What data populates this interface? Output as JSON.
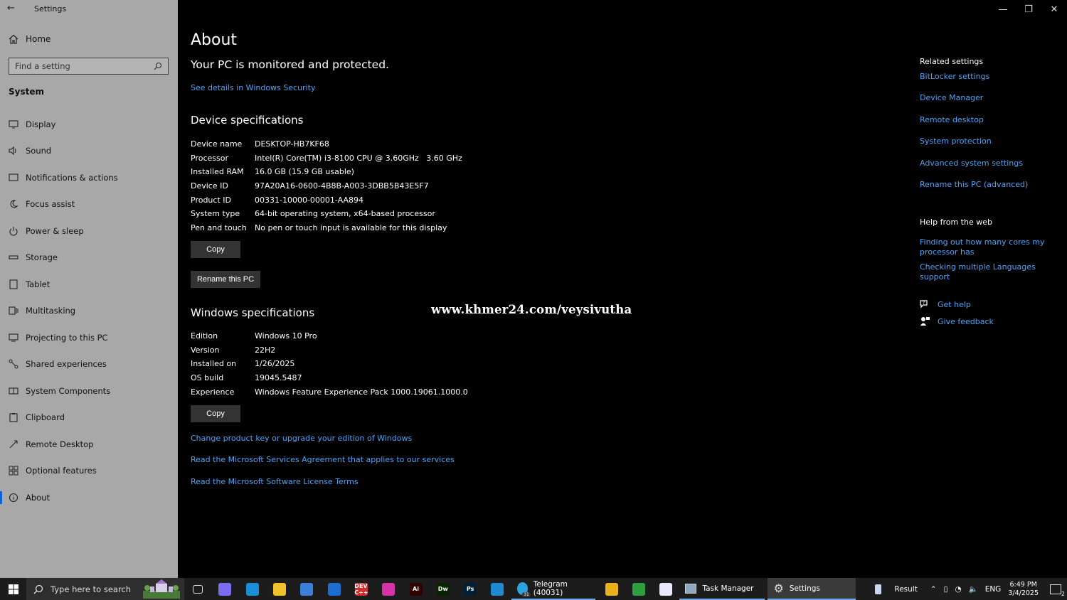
{
  "window": {
    "title": "Settings",
    "back_glyph": "←",
    "minimize_glyph": "—",
    "maximize_glyph": "❐",
    "close_glyph": "✕"
  },
  "sidebar": {
    "home_label": "Home",
    "search_placeholder": "Find a setting",
    "section_title": "System",
    "items": [
      {
        "label": "Display",
        "icon": "display-icon"
      },
      {
        "label": "Sound",
        "icon": "sound-icon"
      },
      {
        "label": "Notifications & actions",
        "icon": "notifications-icon"
      },
      {
        "label": "Focus assist",
        "icon": "moon-icon"
      },
      {
        "label": "Power & sleep",
        "icon": "power-icon"
      },
      {
        "label": "Storage",
        "icon": "storage-icon"
      },
      {
        "label": "Tablet",
        "icon": "tablet-icon"
      },
      {
        "label": "Multitasking",
        "icon": "multitasking-icon"
      },
      {
        "label": "Projecting to this PC",
        "icon": "projecting-icon"
      },
      {
        "label": "Shared experiences",
        "icon": "shared-icon"
      },
      {
        "label": "System Components",
        "icon": "components-icon"
      },
      {
        "label": "Clipboard",
        "icon": "clipboard-icon"
      },
      {
        "label": "Remote Desktop",
        "icon": "remote-desktop-icon"
      },
      {
        "label": "Optional features",
        "icon": "optional-features-icon"
      },
      {
        "label": "About",
        "icon": "info-icon",
        "active": true
      }
    ]
  },
  "main": {
    "title": "About",
    "protection_title": "Your PC is monitored and protected.",
    "security_link": "See details in Windows Security",
    "device_specs_title": "Device specifications",
    "device_specs": [
      {
        "key": "Device name",
        "value": "DESKTOP-HB7KF68"
      },
      {
        "key": "Processor",
        "value": "Intel(R) Core(TM) i3-8100 CPU @ 3.60GHz   3.60 GHz"
      },
      {
        "key": "Installed RAM",
        "value": "16.0 GB (15.9 GB usable)"
      },
      {
        "key": "Device ID",
        "value": "97A20A16-0600-4B8B-A003-3DBB5B43E5F7"
      },
      {
        "key": "Product ID",
        "value": "00331-10000-00001-AA894"
      },
      {
        "key": "System type",
        "value": "64-bit operating system, x64-based processor"
      },
      {
        "key": "Pen and touch",
        "value": "No pen or touch input is available for this display"
      }
    ],
    "copy_label": "Copy",
    "rename_label": "Rename this PC",
    "windows_specs_title": "Windows specifications",
    "windows_specs": [
      {
        "key": "Edition",
        "value": "Windows 10 Pro"
      },
      {
        "key": "Version",
        "value": "22H2"
      },
      {
        "key": "Installed on",
        "value": "1/26/2025"
      },
      {
        "key": "OS build",
        "value": "19045.5487"
      },
      {
        "key": "Experience",
        "value": "Windows Feature Experience Pack 1000.19061.1000.0"
      }
    ],
    "copy2_label": "Copy",
    "links": [
      "Change product key or upgrade your edition of Windows",
      "Read the Microsoft Services Agreement that applies to our services",
      "Read the Microsoft Software License Terms"
    ],
    "watermark": "www.khmer24.com/veysivutha"
  },
  "related": {
    "title": "Related settings",
    "links": [
      "BitLocker settings",
      "Device Manager",
      "Remote desktop",
      "System protection",
      "Advanced system settings",
      "Rename this PC (advanced)"
    ],
    "help_title": "Help from the web",
    "help_links": [
      "Finding out how many cores my processor has",
      "Checking multiple Languages support"
    ],
    "get_help": "Get help",
    "give_feedback": "Give feedback"
  },
  "taskbar": {
    "search_placeholder": "Type here to search",
    "pinned": [
      {
        "name": "task-view-icon",
        "label": "",
        "color": "#1c1c1c"
      },
      {
        "name": "copilot-icon",
        "label": "",
        "color": "#7b6cf0"
      },
      {
        "name": "edge-icon",
        "label": "",
        "color": "#1a8fd8"
      },
      {
        "name": "file-explorer-icon",
        "label": "",
        "color": "#f2c12e"
      },
      {
        "name": "store-icon",
        "label": "",
        "color": "#3b7fd9"
      },
      {
        "name": "outlook-icon",
        "label": "",
        "color": "#1b6fd1"
      },
      {
        "name": "devcpp-icon",
        "label": "DEV C++",
        "color": "#d12b2b"
      },
      {
        "name": "jetbrains-icon",
        "label": "",
        "color": "#d633a6"
      },
      {
        "name": "illustrator-icon",
        "label": "Ai",
        "color": "#330000"
      },
      {
        "name": "dreamweaver-icon",
        "label": "Dw",
        "color": "#072401"
      },
      {
        "name": "photoshop-icon",
        "label": "Ps",
        "color": "#001e36"
      },
      {
        "name": "vscode-icon",
        "label": "",
        "color": "#1f8ad2"
      }
    ],
    "telegram_label": "Telegram (40031)",
    "telegram_badge": "31",
    "after_telegram": [
      {
        "name": "chrome-icon",
        "label": "",
        "color": "#e8b21e"
      },
      {
        "name": "app-icon",
        "label": "",
        "color": "#2e9e3e"
      },
      {
        "name": "wavy-app-icon",
        "label": "",
        "color": "#e9e9ff"
      }
    ],
    "task_manager_label": "Task Manager",
    "settings_label": "Settings",
    "tray": {
      "news_label": "Result",
      "language": "ENG",
      "time": "6:49 PM",
      "date": "3/4/2025",
      "notification_count": "2"
    }
  }
}
